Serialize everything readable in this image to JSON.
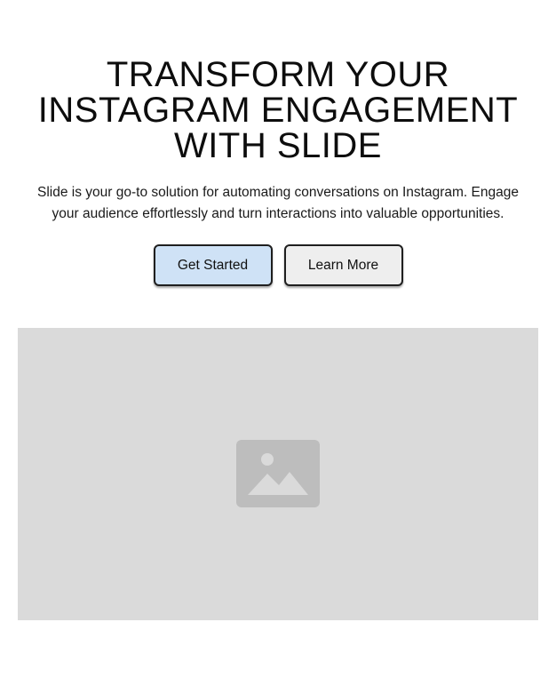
{
  "hero": {
    "headline_lines": [
      "TRANSFORM YOUR",
      "INSTAGRAM ENGAGEMENT",
      "WITH SLIDE"
    ],
    "subtext_lines": [
      "Slide is your go-to solution for automating conversations on Instagram. Engage",
      "your audience effortlessly and turn interactions into valuable opportunities."
    ]
  },
  "actions": {
    "primary_label": "Get Started",
    "secondary_label": "Learn More"
  },
  "media": {
    "icon": "image-placeholder-icon"
  },
  "colors": {
    "primary_button_bg": "#cfe2f6",
    "secondary_button_bg": "#eeeeee",
    "placeholder_bg": "#dadada",
    "placeholder_icon": "#bdbdbd"
  }
}
